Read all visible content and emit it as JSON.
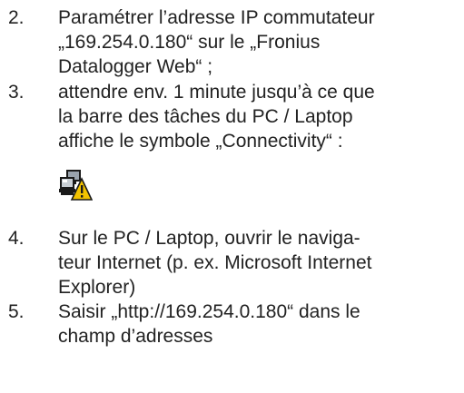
{
  "steps": [
    {
      "number": "2.",
      "lines": [
        "Paramétrer l’adresse IP commutateur",
        "„169.254.0.180“ sur le „Fronius",
        "Datalogger Web“ ;"
      ]
    },
    {
      "number": "3.",
      "lines": [
        "attendre env. 1 minute jusqu’à ce que",
        "la barre des tâches du PC / Laptop",
        "affiche le symbole „Connectivity“ :"
      ]
    },
    {
      "number": "4.",
      "lines": [
        "Sur le PC / Laptop, ouvrir le naviga-",
        "teur Internet (p. ex. Microsoft Internet",
        "Explorer)"
      ]
    },
    {
      "number": "5.",
      "lines": [
        "Saisir „http://169.254.0.180“ dans le",
        "champ d’adresses"
      ]
    }
  ],
  "icon": {
    "name": "connectivity-warning-icon",
    "colors": {
      "monitor": "#1a1a1a",
      "screen": "#9aa3ad",
      "warning": "#f2c200",
      "warning_outline": "#1a1a1a"
    }
  }
}
